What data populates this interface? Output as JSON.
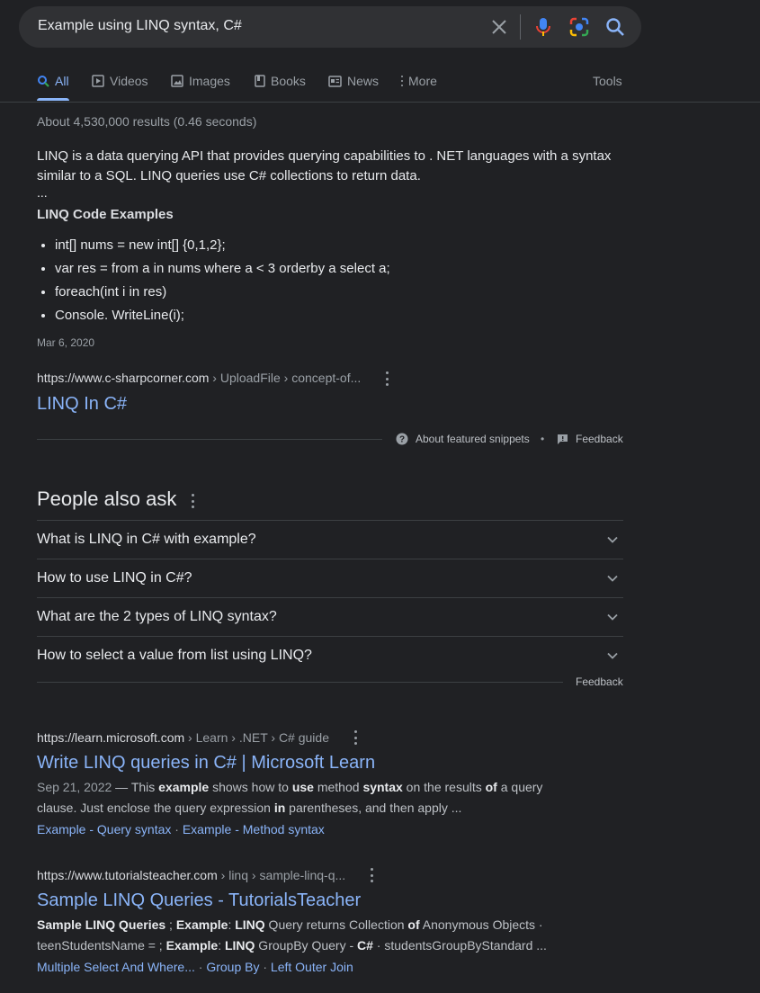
{
  "search": {
    "query": "Example using LINQ syntax, C#"
  },
  "tabs": [
    {
      "label": "All",
      "icon": "search-icon"
    },
    {
      "label": "Videos",
      "icon": "video-icon"
    },
    {
      "label": "Images",
      "icon": "image-icon"
    },
    {
      "label": "Books",
      "icon": "book-icon"
    },
    {
      "label": "News",
      "icon": "news-icon"
    },
    {
      "label": "More",
      "icon": "more-vert-icon"
    }
  ],
  "tools_label": "Tools",
  "result_stats": "About 4,530,000 results (0.46 seconds)",
  "featured_snippet": {
    "text": "LINQ is a data querying API that provides querying capabilities to . NET languages with a syntax similar to a SQL. LINQ queries use C# collections to return data.",
    "ellipsis": "...",
    "heading": "LINQ Code Examples",
    "items": [
      "int[] nums = new int[] {0,1,2};",
      "var res = from a in nums where a < 3 orderby a select a;",
      "foreach(int i in res)",
      "Console. WriteLine(i);"
    ],
    "date": "Mar 6, 2020",
    "url_domain": "https://www.c-sharpcorner.com",
    "url_path": " › UploadFile › concept-of...",
    "title": "LINQ In C#",
    "about_label": "About featured snippets",
    "bullet": "•",
    "feedback_label": "Feedback"
  },
  "people_also_ask": {
    "title": "People also ask",
    "questions": [
      "What is LINQ in C# with example?",
      "How to use LINQ in C#?",
      "What are the 2 types of LINQ syntax?",
      "How to select a value from list using LINQ?"
    ],
    "feedback_label": "Feedback"
  },
  "results": [
    {
      "url_domain": "https://learn.microsoft.com",
      "url_path": " › Learn › .NET › C# guide",
      "title": "Write LINQ queries in C# | Microsoft Learn",
      "date": "Sep 21, 2022",
      "dash": " — ",
      "desc_parts": [
        "This ",
        "example",
        " shows how to ",
        "use",
        " method ",
        "syntax",
        " on the results ",
        "of",
        " a query clause. Just enclose the query expression ",
        "in",
        " parentheses, and then apply ..."
      ],
      "sitelinks": [
        "Example - Query syntax",
        "Example - Method syntax"
      ]
    },
    {
      "url_domain": "https://www.tutorialsteacher.com",
      "url_path": " › linq › sample-linq-q...",
      "title": "Sample LINQ Queries - TutorialsTeacher",
      "desc_parts": [
        "Sample LINQ Queries",
        " ; ",
        "Example",
        ": ",
        "LINQ",
        " Query returns Collection ",
        "of",
        " Anonymous Objects · teenStudentsName = ; ",
        "Example",
        ": ",
        "LINQ",
        " GroupBy Query - ",
        "C#",
        " · studentsGroupByStandard ..."
      ],
      "sitelinks": [
        "Multiple Select And Where...",
        "Group By",
        "Left Outer Join"
      ]
    }
  ],
  "sitelink_separator": " · ",
  "colors": {
    "background": "#202124",
    "link": "#8ab4f8",
    "text": "#e8eaed",
    "muted": "#9aa0a6",
    "divider": "#3c4043"
  }
}
